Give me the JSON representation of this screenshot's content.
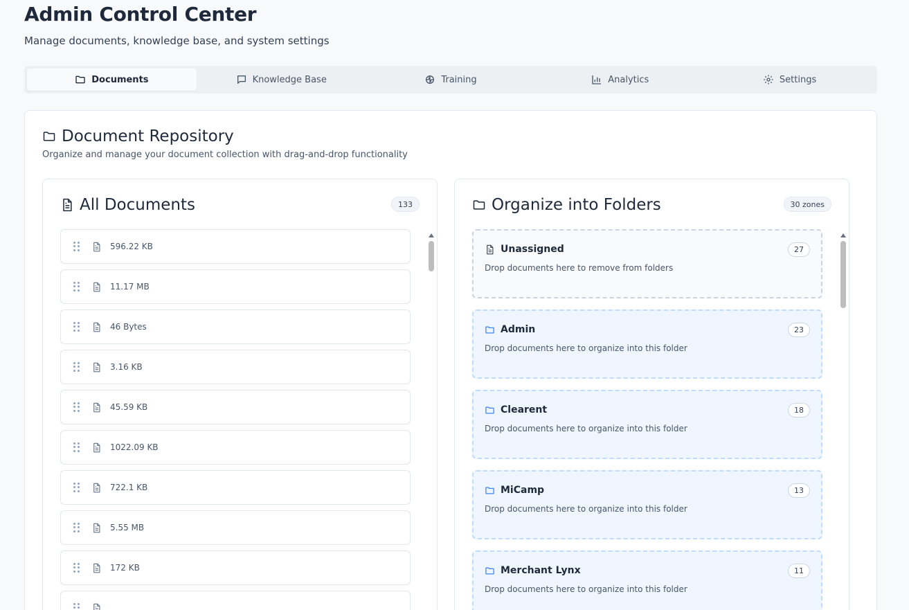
{
  "header": {
    "title": "Admin Control Center",
    "subtitle": "Manage documents, knowledge base, and system settings"
  },
  "tabs": [
    {
      "label": "Documents",
      "icon": "folder-icon",
      "active": true
    },
    {
      "label": "Knowledge Base",
      "icon": "chat-icon",
      "active": false
    },
    {
      "label": "Training",
      "icon": "brain-icon",
      "active": false
    },
    {
      "label": "Analytics",
      "icon": "bar-chart-icon",
      "active": false
    },
    {
      "label": "Settings",
      "icon": "gear-icon",
      "active": false
    }
  ],
  "repository": {
    "title": "Document Repository",
    "description": "Organize and manage your document collection with drag-and-drop functionality"
  },
  "all_documents": {
    "title": "All Documents",
    "count": "133",
    "items": [
      {
        "size": "596.22 KB"
      },
      {
        "size": "11.17 MB"
      },
      {
        "size": "46 Bytes"
      },
      {
        "size": "3.16 KB"
      },
      {
        "size": "45.59 KB"
      },
      {
        "size": "1022.09 KB"
      },
      {
        "size": "722.1 KB"
      },
      {
        "size": "5.55 MB"
      },
      {
        "size": "172 KB"
      },
      {
        "size": ""
      }
    ]
  },
  "folders": {
    "title": "Organize into Folders",
    "count": "30 zones",
    "zones": [
      {
        "name": "Unassigned",
        "description": "Drop documents here to remove from folders",
        "count": "27",
        "type": "unassigned",
        "icon": "document-icon"
      },
      {
        "name": "Admin",
        "description": "Drop documents here to organize into this folder",
        "count": "23",
        "type": "folder",
        "icon": "folder-icon"
      },
      {
        "name": "Clearent",
        "description": "Drop documents here to organize into this folder",
        "count": "18",
        "type": "folder",
        "icon": "folder-icon"
      },
      {
        "name": "MiCamp",
        "description": "Drop documents here to organize into this folder",
        "count": "13",
        "type": "folder",
        "icon": "folder-icon"
      },
      {
        "name": "Merchant Lynx",
        "description": "Drop documents here to organize into this folder",
        "count": "11",
        "type": "folder",
        "icon": "folder-icon"
      }
    ]
  },
  "colors": {
    "folder_icon": "#3b82f6",
    "zone_border": "#bfdbfe",
    "zone_bg": "#eff6ff"
  }
}
